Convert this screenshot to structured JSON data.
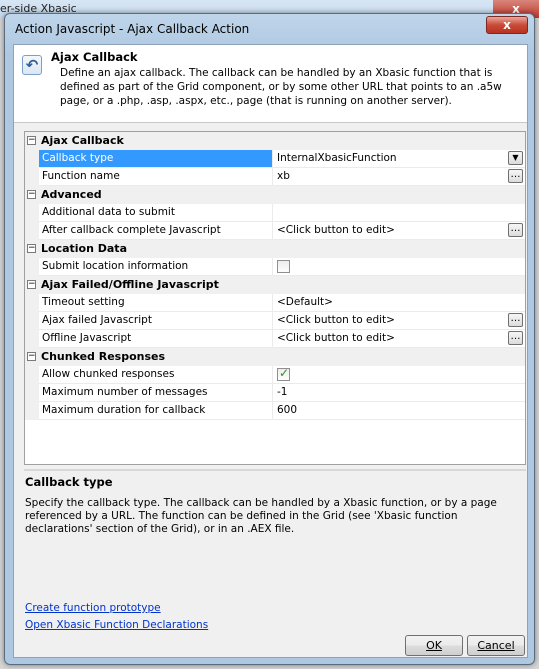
{
  "background_window": {
    "title": "er-side Xbasic",
    "close_glyph": "x"
  },
  "dialog": {
    "title": "Action Javascript - Ajax Callback Action",
    "close_glyph": "x"
  },
  "header": {
    "icon": "ajax-callback-icon",
    "title": "Ajax Callback",
    "description": "Define an ajax callback. The callback can be handled by an Xbasic function that is defined as part of the Grid component, or by some other URL that points to an .a5w page, or a .php, .asp, .aspx, etc., page (that is running on another server)."
  },
  "property_grid": {
    "categories": [
      {
        "label": "Ajax Callback",
        "properties": [
          {
            "name": "Callback type",
            "value": "InternalXbasicFunction",
            "selected": true,
            "editor": "dropdown"
          },
          {
            "name": "Function name",
            "value": "xb",
            "editor": "ellipsis"
          }
        ]
      },
      {
        "label": "Advanced",
        "properties": [
          {
            "name": "Additional data to submit",
            "value": "",
            "editor": "none"
          },
          {
            "name": "After callback complete Javascript",
            "value": "<Click button to edit>",
            "editor": "ellipsis"
          }
        ]
      },
      {
        "label": "Location Data",
        "properties": [
          {
            "name": "Submit location information",
            "value": "",
            "editor": "checkbox",
            "checked": false
          }
        ]
      },
      {
        "label": "Ajax Failed/Offline Javascript",
        "properties": [
          {
            "name": "Timeout setting",
            "value": "<Default>",
            "editor": "none"
          },
          {
            "name": "Ajax failed Javascript",
            "value": "<Click button to edit>",
            "editor": "ellipsis"
          },
          {
            "name": "Offline Javascript",
            "value": "<Click button to edit>",
            "editor": "ellipsis"
          }
        ]
      },
      {
        "label": "Chunked Responses",
        "properties": [
          {
            "name": "Allow chunked responses",
            "value": "",
            "editor": "checkbox",
            "checked": true
          },
          {
            "name": "Maximum number of messages",
            "value": "-1",
            "editor": "none"
          },
          {
            "name": "Maximum duration for callback",
            "value": "600",
            "editor": "none"
          }
        ]
      }
    ]
  },
  "help": {
    "title": "Callback type",
    "text": "Specify the callback type. The callback can be handled by a Xbasic function, or by a page referenced by a URL. The function can be defined in the Grid (see 'Xbasic function declarations' section of the Grid), or in an .AEX file."
  },
  "links": {
    "create_prototype": "Create function prototype",
    "open_declarations": "Open Xbasic Function Declarations"
  },
  "buttons": {
    "ok": "OK",
    "cancel": "Cancel"
  },
  "colors": {
    "selection": "#3399ff",
    "link": "#0033cc",
    "check": "#2d8c2d"
  }
}
